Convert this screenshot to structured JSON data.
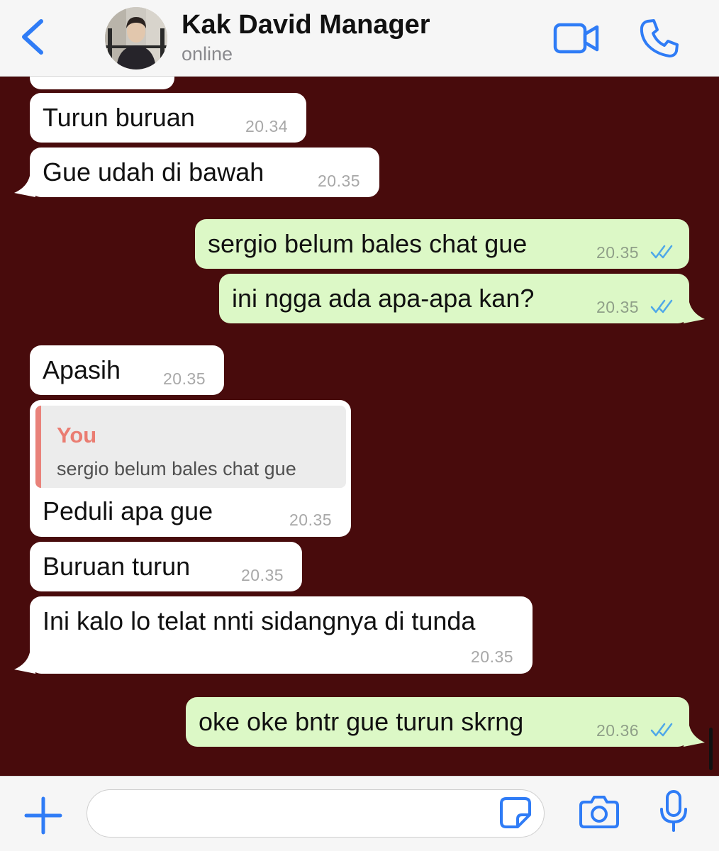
{
  "header": {
    "contact_name": "Kak David Manager",
    "status": "online",
    "back_icon": "chevron-left-icon",
    "video_icon": "video-camera-icon",
    "call_icon": "phone-icon",
    "accent_color": "#2f7cf6"
  },
  "chat": {
    "background_color": "#480b0c",
    "incoming_bubble_color": "#ffffff",
    "outgoing_bubble_color": "#dcf8c6",
    "read_tick_color": "#4fa8e8",
    "messages": [
      {
        "direction": "in",
        "text": "Turun buruan",
        "time": "20.34"
      },
      {
        "direction": "in",
        "text": "Gue udah di bawah",
        "time": "20.35"
      },
      {
        "direction": "out",
        "text": "sergio belum bales chat gue",
        "time": "20.35",
        "status": "read"
      },
      {
        "direction": "out",
        "text": "ini ngga ada apa-apa kan?",
        "time": "20.35",
        "status": "read"
      },
      {
        "direction": "in",
        "text": "Apasih",
        "time": "20.35"
      },
      {
        "direction": "in",
        "text": "Peduli apa gue",
        "time": "20.35",
        "reply_to": {
          "author": "You",
          "text": "sergio belum bales chat gue"
        }
      },
      {
        "direction": "in",
        "text": "Buruan turun",
        "time": "20.35"
      },
      {
        "direction": "in",
        "text": "Ini kalo lo telat nnti sidangnya di tunda",
        "time": "20.35"
      },
      {
        "direction": "out",
        "text": "oke oke bntr gue turun skrng",
        "time": "20.36",
        "status": "read"
      }
    ]
  },
  "composer": {
    "input_value": "",
    "input_placeholder": "",
    "plus_icon": "plus-icon",
    "sticker_icon": "sticker-icon",
    "camera_icon": "camera-icon",
    "mic_icon": "microphone-icon"
  }
}
